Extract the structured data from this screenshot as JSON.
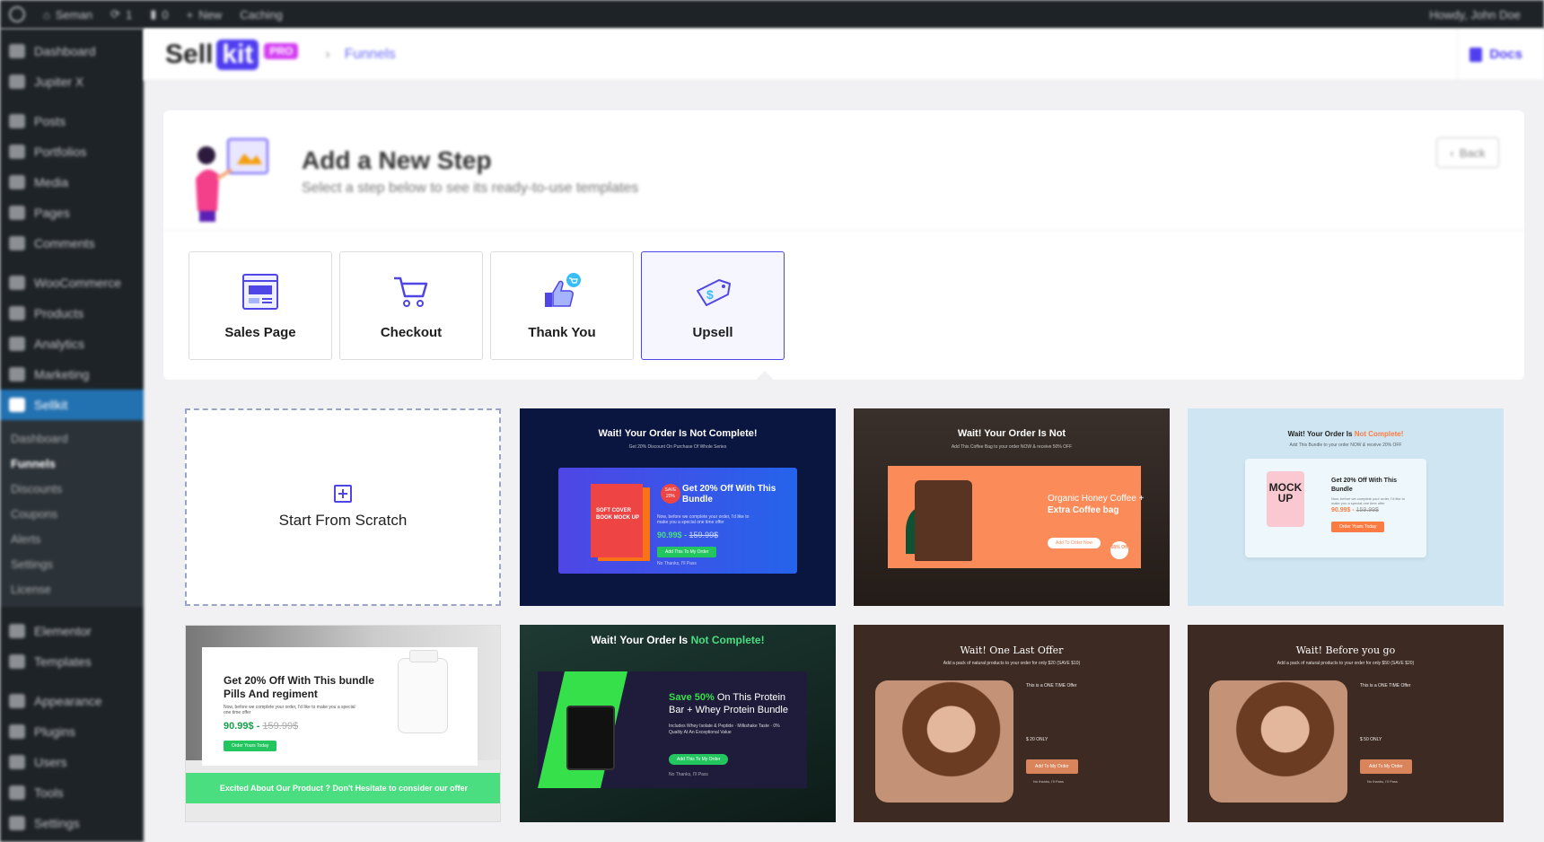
{
  "colors": {
    "accent": "#4f46e5",
    "wp_sidebar": "#1d2327",
    "wp_active": "#2271b1",
    "brand_pink": "#d43ef2",
    "success_green": "#22c55e"
  },
  "admin_bar": {
    "site_name": "Seman",
    "updates_count": "1",
    "comments_count": "0",
    "new_label": "New",
    "caching_label": "Caching",
    "greeting": "Howdy, John Doe"
  },
  "sidebar": {
    "items": [
      {
        "label": "Dashboard",
        "icon": "dashboard-icon"
      },
      {
        "label": "Jupiter X",
        "icon": "jupiter-icon"
      },
      {
        "label": "Posts",
        "icon": "pin-icon"
      },
      {
        "label": "Portfolios",
        "icon": "pin-icon"
      },
      {
        "label": "Media",
        "icon": "media-icon"
      },
      {
        "label": "Pages",
        "icon": "pages-icon"
      },
      {
        "label": "Comments",
        "icon": "comments-icon"
      },
      {
        "label": "WooCommerce",
        "icon": "woocommerce-icon"
      },
      {
        "label": "Products",
        "icon": "products-icon"
      },
      {
        "label": "Analytics",
        "icon": "analytics-icon"
      },
      {
        "label": "Marketing",
        "icon": "marketing-icon"
      },
      {
        "label": "Sellkit",
        "icon": "sellkit-icon"
      },
      {
        "label": "Elementor",
        "icon": "elementor-icon"
      },
      {
        "label": "Templates",
        "icon": "templates-icon"
      },
      {
        "label": "Appearance",
        "icon": "appearance-icon"
      },
      {
        "label": "Plugins",
        "icon": "plugins-icon"
      },
      {
        "label": "Users",
        "icon": "users-icon"
      },
      {
        "label": "Tools",
        "icon": "tools-icon"
      },
      {
        "label": "Settings",
        "icon": "settings-icon"
      }
    ],
    "submenu": [
      "Dashboard",
      "Funnels",
      "Discounts",
      "Coupons",
      "Alerts",
      "Settings",
      "License"
    ]
  },
  "header": {
    "brand_sell": "Sell",
    "brand_kit": "kit",
    "brand_pro": "PRO",
    "breadcrumb_sep": "›",
    "breadcrumb": "Funnels",
    "docs_label": "Docs"
  },
  "panel": {
    "title": "Add a New Step",
    "subtitle": "Select a step below to see its ready-to-use templates",
    "back_label": "Back",
    "steps": [
      {
        "label": "Sales Page",
        "icon": "sales-page-icon"
      },
      {
        "label": "Checkout",
        "icon": "cart-icon"
      },
      {
        "label": "Thank You",
        "icon": "thumbs-up-icon"
      },
      {
        "label": "Upsell",
        "icon": "price-tag-icon"
      }
    ],
    "active_step": "Upsell"
  },
  "templates": {
    "scratch_label": "Start From Scratch",
    "t1": {
      "title": "Wait! Your Order Is Not Complete!",
      "subtitle": "Get 20% Discount On Purchase Of Whole Series",
      "book_text": "SOFT COVER BOOK MOCK UP",
      "badge": "SAVE 20%",
      "heading": "Get 20% Off With This Bundle",
      "body": "Now, before we complete your order, I'd like to make you a special one time offer",
      "price": "90.99$ -",
      "old_price": "159.99$",
      "button": "Add This To My Order",
      "no_thanks": "No Thanks, I'll Pass"
    },
    "t2": {
      "title": "Wait! Your Order Is Not",
      "subtitle": "Add This Coffee Bag to your order NOW & receive 50% OFF",
      "heading_light": "Organic Honey Coffee +",
      "heading_bold": "Extra Coffee bag",
      "button": "Add To Order Now",
      "badge": "50% Off"
    },
    "t3": {
      "title_a": "Wait! Your Order Is",
      "title_b": "Not Complete!",
      "subtitle": "Add This Bundle to your order NOW & receive 20% OFF",
      "bag_text": "MOCK UP",
      "heading": "Get 20% Off With This Bundle",
      "body": "Now, before we complete your order, I'd like to make you a special one time offer",
      "price": "90.99$ -",
      "old_price": "159.99$",
      "button": "Order Yours Today"
    },
    "t4": {
      "heading": "Get 20% Off With This bundle Pills And regiment",
      "body": "Now, before we complete your order, I'd like to make you a special one time offer",
      "price": "90.99$ -",
      "old_price": "159.99$",
      "button": "Order Yours Today",
      "banner": "Excited About Our Product ? Don't Hesitate to consider our offer"
    },
    "t5": {
      "title_a": "Wait! Your Order Is",
      "title_b": "Not Complete!",
      "heading_bold": "Save 50%",
      "heading": "On This Protein Bar + Whey Protein Bundle",
      "body": "Includes Whey Isolate & Peptide · Milkshake Taste · 0% Quality At An Exceptional Value",
      "button": "Add This To My Order",
      "no_thanks": "No Thanks, I'll Pass"
    },
    "t6": {
      "title": "Wait! One Last Offer",
      "subtitle": "Add a pack of natural products to your order for only $20 (SAVE $10)",
      "info": "This is a ONE TIME Offer",
      "price": "$ 20 ONLY",
      "button": "Add To My Order",
      "no_thanks": "No thanks, I'll Pass"
    },
    "t7": {
      "title": "Wait! Before you go",
      "subtitle": "Add a pack of natural products to your order for only $50 (SAVE $20)",
      "info": "This is a ONE TIME Offer",
      "price": "$ 50 ONLY",
      "button": "Add To My Order",
      "no_thanks": "No thanks, I'll Pass"
    }
  }
}
